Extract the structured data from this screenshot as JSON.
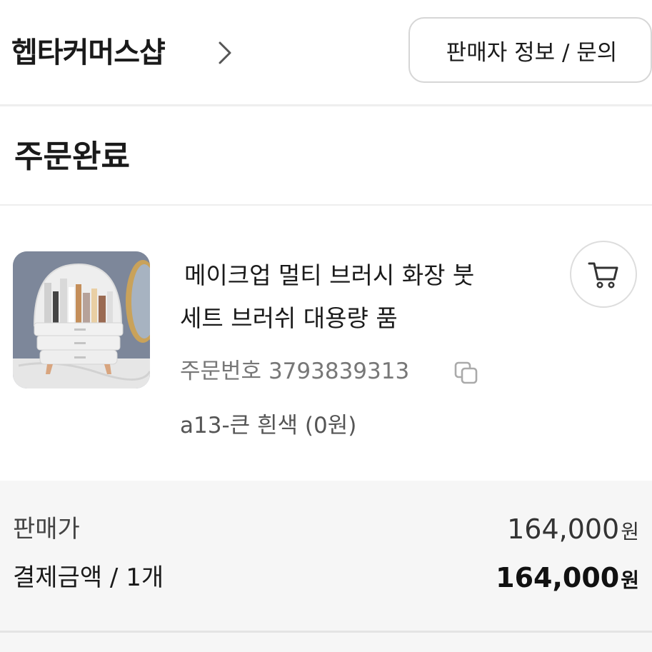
{
  "header": {
    "shop_name": "헵타커머스샵",
    "seller_button_label": "판매자 정보 / 문의"
  },
  "status_title": "주문완료",
  "product": {
    "name_line1": "메이크업 멀티 브러시 화장 붓",
    "name_line2": "세트 브러쉬 대용량 품",
    "order_number_label": "주문번호",
    "order_number": "3793839313",
    "option": "a13-큰 흰색 (0원)"
  },
  "price": {
    "sale_label": "판매가",
    "sale_value": "164,000",
    "paid_label": "결제금액 / 1개",
    "paid_value": "164,000",
    "currency": "원"
  },
  "icons": {
    "chevron": "chevron-right-icon",
    "cart": "cart-icon",
    "copy": "copy-icon"
  }
}
